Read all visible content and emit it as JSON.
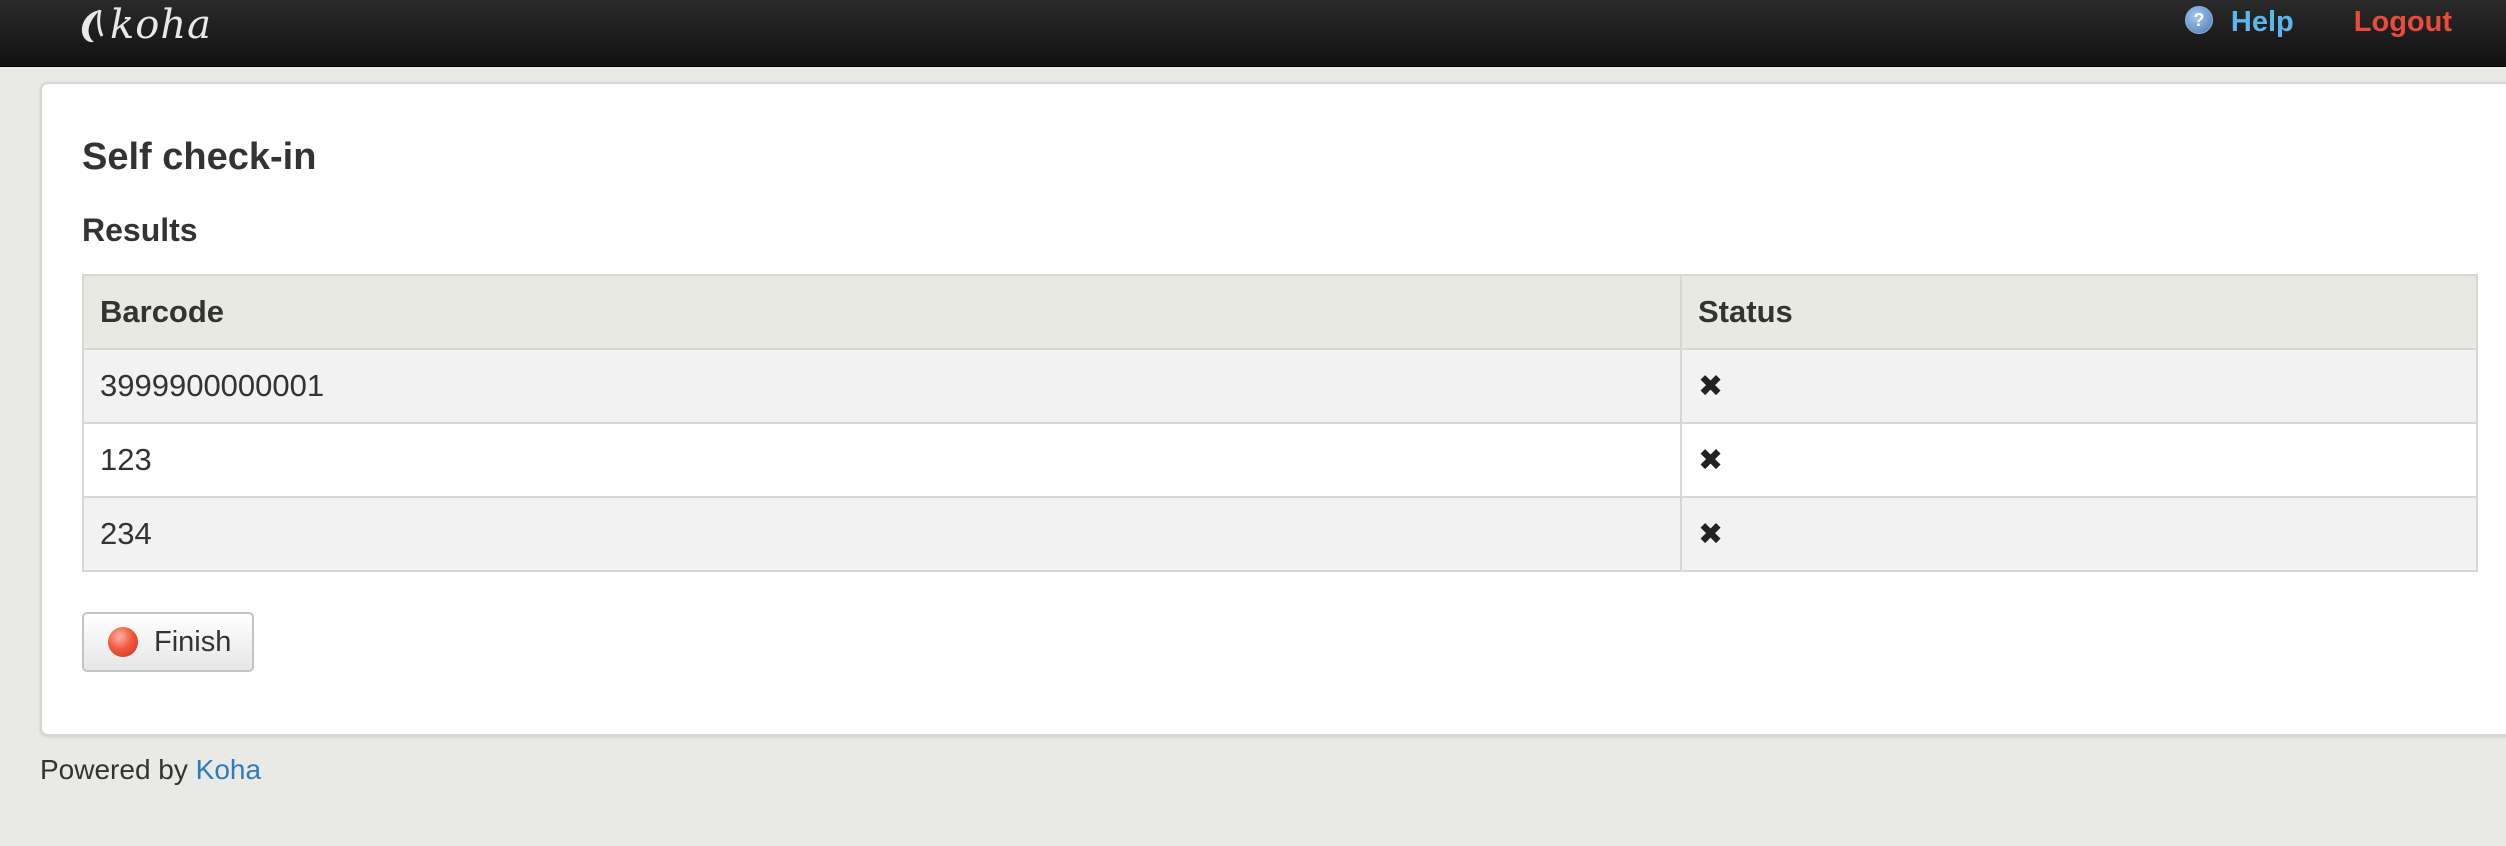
{
  "header": {
    "brand": "koha",
    "help_label": "Help",
    "logout_label": "Logout"
  },
  "main": {
    "title": "Self check-in",
    "section_title": "Results",
    "table": {
      "columns": [
        "Barcode",
        "Status"
      ],
      "rows": [
        {
          "barcode": "3999900000001",
          "status_icon": "x-icon"
        },
        {
          "barcode": "123",
          "status_icon": "x-icon"
        },
        {
          "barcode": "234",
          "status_icon": "x-icon"
        }
      ]
    },
    "finish_label": "Finish"
  },
  "footer": {
    "powered_by": "Powered by",
    "link_text": "Koha"
  },
  "colors": {
    "help": "#5bb7ee",
    "logout": "#ea4c3a",
    "link": "#2e7cc0",
    "finish_dot": "#f25a3e"
  }
}
